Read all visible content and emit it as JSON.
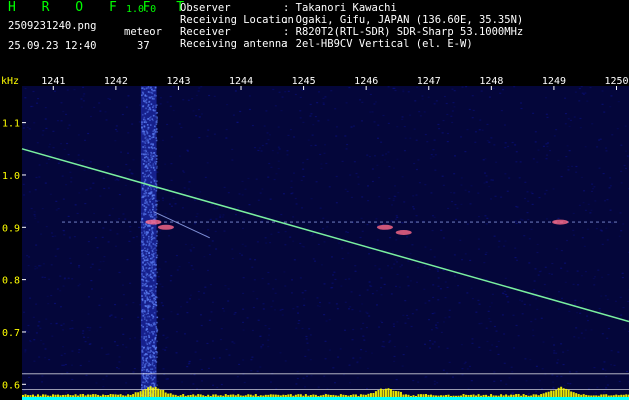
{
  "header": {
    "brand": "H R O F F T",
    "version": "1.0.0",
    "filename": "2509231240.png",
    "timestamp": "25.09.23 12:40",
    "detection_label": "meteor",
    "detection_count": "37",
    "info": [
      {
        "label": "Observer",
        "value": ": Takanori Kawachi"
      },
      {
        "label": "Receiving Location",
        "value": ": Ogaki, Gifu, JAPAN (136.60E, 35.35N)"
      },
      {
        "label": "Receiver",
        "value": ": R820T2(RTL-SDR) SDR-Sharp 53.1000MHz"
      },
      {
        "label": "Receiving antenna",
        "value": ": 2el-HB9CV Vertical (el. E-W)"
      }
    ]
  },
  "chart_data": {
    "type": "heatmap",
    "ylabel": "kHz",
    "x_ticks": [
      "1241",
      "1242",
      "1243",
      "1244",
      "1245",
      "1246",
      "1247",
      "1248",
      "1249",
      "1250"
    ],
    "y_ticks": [
      "1.1",
      "1.0",
      "0.9",
      "0.8",
      "0.7",
      "0.6"
    ],
    "x_range": [
      1240.5,
      1250.2
    ],
    "y_range": [
      0.57,
      1.17
    ],
    "noise_band_x": [
      1242.4,
      1242.65
    ],
    "carrier_freq_khz": 0.91,
    "sweep_line": {
      "x": [
        1240.5,
        1250.2
      ],
      "y": [
        1.05,
        0.72
      ]
    },
    "secondary_line": {
      "x": [
        1242.6,
        1243.5
      ],
      "y": [
        0.93,
        0.88
      ]
    },
    "meteor_echoes": [
      {
        "time": 1242.6,
        "freq": 0.91
      },
      {
        "time": 1242.8,
        "freq": 0.9
      },
      {
        "time": 1246.3,
        "freq": 0.9
      },
      {
        "time": 1246.6,
        "freq": 0.89
      },
      {
        "time": 1249.1,
        "freq": 0.91
      }
    ],
    "reference_lines_khz": [
      0.62,
      0.59
    ],
    "colors": {
      "background": "#000000",
      "noise": "#0a1080",
      "band": "#5a7cf0",
      "sweep": "#7af0a0",
      "carrier": "#a0b4ff",
      "tick_text": "#ffffff",
      "axis_text": "#ffff00",
      "spectrum_baseline": "#00ffff",
      "spectrum_peaks": "#ffff00"
    }
  }
}
